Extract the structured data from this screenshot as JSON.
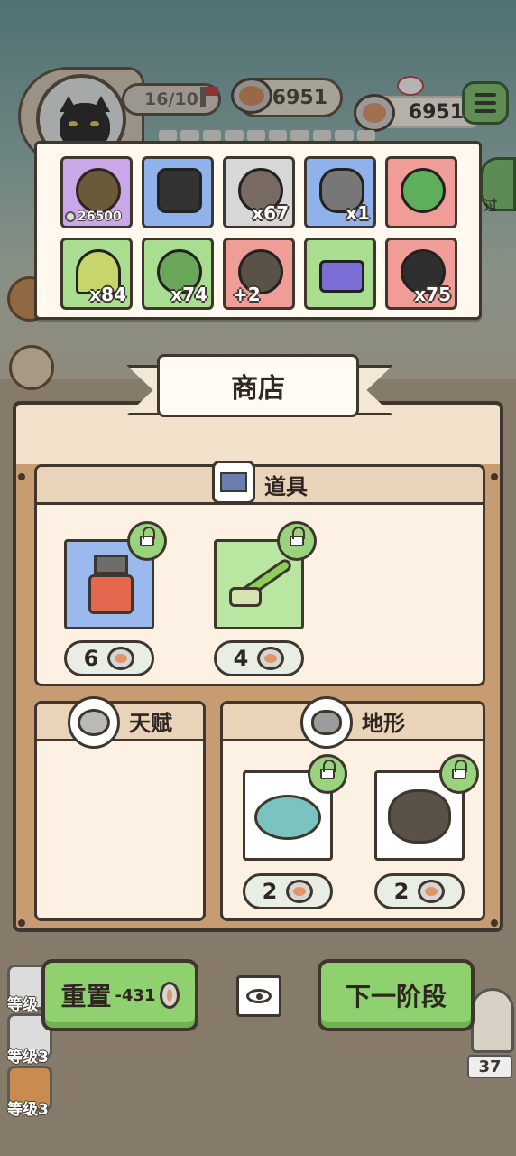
{
  "hud": {
    "level_progress": "16/10",
    "cans_total": "6951",
    "cans_small": "6951"
  },
  "inventory": {
    "items": [
      {
        "name": "film-reel",
        "color": "purple",
        "price": "26500",
        "count": ""
      },
      {
        "name": "camera",
        "color": "blue",
        "price": "",
        "count": ""
      },
      {
        "name": "tank-machine",
        "color": "grey",
        "price": "",
        "count": "x67"
      },
      {
        "name": "tin-can",
        "color": "blue",
        "price": "",
        "count": "x1"
      },
      {
        "name": "green-orb",
        "color": "red",
        "price": "",
        "count": ""
      },
      {
        "name": "tent",
        "color": "green",
        "price": "",
        "count": "x84"
      },
      {
        "name": "leaf-bundle",
        "color": "green",
        "price": "",
        "count": "x74"
      },
      {
        "name": "gold-rock",
        "color": "red",
        "price": "",
        "count": "+2"
      },
      {
        "name": "card",
        "color": "green",
        "price": "",
        "count": ""
      },
      {
        "name": "black-bag",
        "color": "red",
        "price": "",
        "count": "x75"
      }
    ]
  },
  "shop": {
    "title": "商店",
    "tools": {
      "title": "道具",
      "items": [
        {
          "name": "coffee-grinder",
          "price": "6"
        },
        {
          "name": "brush",
          "price": "4"
        }
      ]
    },
    "talent": {
      "title": "天赋"
    },
    "terrain": {
      "title": "地形",
      "items": [
        {
          "name": "pond",
          "price": "2"
        },
        {
          "name": "rock",
          "price": "2"
        }
      ]
    }
  },
  "actions": {
    "reset_label": "重置",
    "reset_cost": "-431",
    "next_label": "下一阶段"
  },
  "side": {
    "level_labels": [
      "等级",
      "等级3",
      "等级3"
    ],
    "counter": "37",
    "side_text": "过"
  }
}
